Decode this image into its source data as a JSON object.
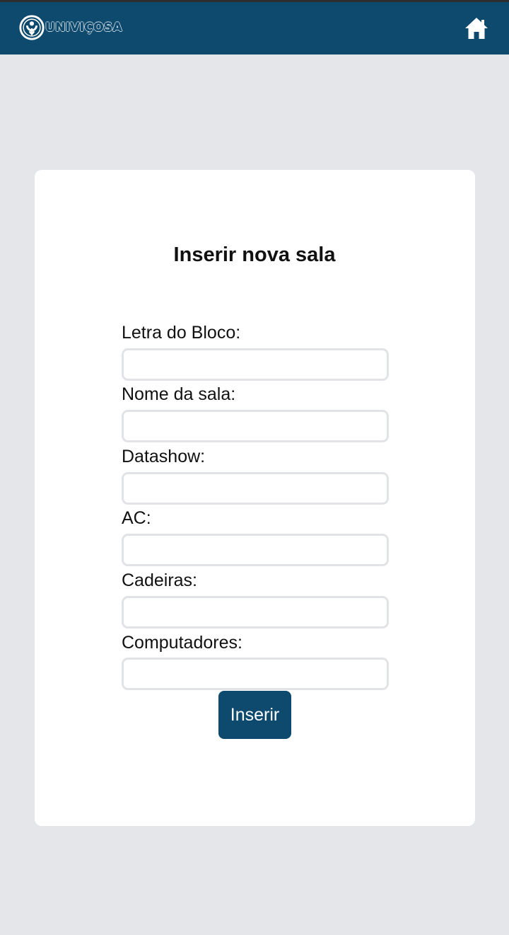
{
  "header": {
    "logo_text": "UNIVIÇOSA",
    "home_icon": "home-icon",
    "background": "#0d4a6e"
  },
  "form": {
    "title": "Inserir nova sala",
    "fields": [
      {
        "label": "Letra do Bloco:",
        "value": ""
      },
      {
        "label": "Nome da sala:",
        "value": ""
      },
      {
        "label": "Datashow:",
        "value": ""
      },
      {
        "label": "AC:",
        "value": ""
      },
      {
        "label": "Cadeiras:",
        "value": ""
      },
      {
        "label": "Computadores:",
        "value": ""
      }
    ],
    "submit_label": "Inserir"
  },
  "colors": {
    "primary": "#0d4a6e",
    "page_background": "#e5e6ea",
    "card_background": "#ffffff"
  }
}
